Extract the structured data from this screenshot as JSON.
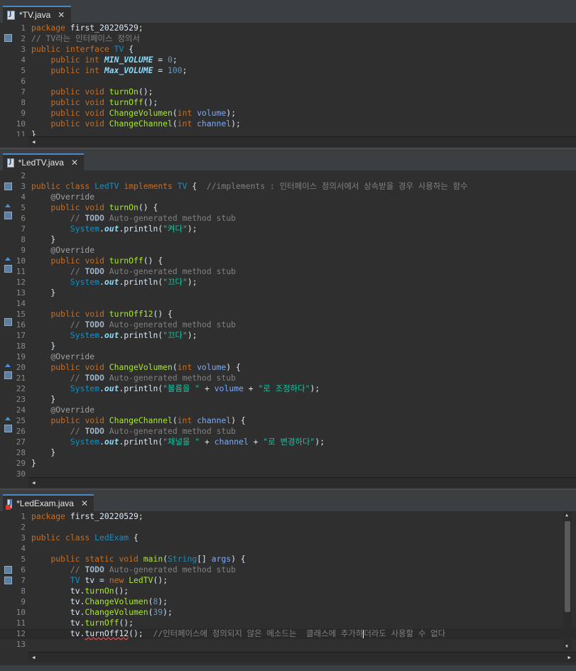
{
  "panes": [
    {
      "tab_label": "*TV.java",
      "lines": [
        {
          "n": "1",
          "code": "package first_20220529;"
        },
        {
          "n": "2",
          "code": "// TV라는 인터페이스 정의서"
        },
        {
          "n": "3",
          "code": "public interface TV {"
        },
        {
          "n": "4",
          "code": "    public int MIN_VOLUME = 0;"
        },
        {
          "n": "5",
          "code": "    public int Max_VOLUME = 100;"
        },
        {
          "n": "6",
          "code": ""
        },
        {
          "n": "7",
          "code": "    public void turnOn();"
        },
        {
          "n": "8",
          "code": "    public void turnOff();"
        },
        {
          "n": "9",
          "code": "    public void ChangeVolumen(int volume);"
        },
        {
          "n": "10",
          "code": "    public void ChangeChannel(int channel);"
        },
        {
          "n": "11",
          "code": "}"
        }
      ]
    },
    {
      "tab_label": "*LedTV.java",
      "lines": [
        {
          "n": "2",
          "code": ""
        },
        {
          "n": "3",
          "code": "public class LedTV implements TV {  //implements : 인터페이스 정의서에서 상속받을 경우 사용하는 함수"
        },
        {
          "n": "4",
          "code": "    @Override"
        },
        {
          "n": "5",
          "code": "    public void turnOn() {"
        },
        {
          "n": "6",
          "code": "        // TODO Auto-generated method stub"
        },
        {
          "n": "7",
          "code": "        System.out.println(\"켜다\");"
        },
        {
          "n": "8",
          "code": "    }"
        },
        {
          "n": "9",
          "code": "    @Override"
        },
        {
          "n": "10",
          "code": "    public void turnOff() {"
        },
        {
          "n": "11",
          "code": "        // TODO Auto-generated method stub"
        },
        {
          "n": "12",
          "code": "        System.out.println(\"끄다\");"
        },
        {
          "n": "13",
          "code": "    }"
        },
        {
          "n": "14",
          "code": ""
        },
        {
          "n": "15",
          "code": "    public void turnOff12() {"
        },
        {
          "n": "16",
          "code": "        // TODO Auto-generated method stub"
        },
        {
          "n": "17",
          "code": "        System.out.println(\"끄다\");"
        },
        {
          "n": "18",
          "code": "    }"
        },
        {
          "n": "19",
          "code": "    @Override"
        },
        {
          "n": "20",
          "code": "    public void ChangeVolumen(int volume) {"
        },
        {
          "n": "21",
          "code": "        // TODO Auto-generated method stub"
        },
        {
          "n": "22",
          "code": "        System.out.println(\"볼륨을 \" + volume + \"로 조정하다\");"
        },
        {
          "n": "23",
          "code": "    }"
        },
        {
          "n": "24",
          "code": "    @Override"
        },
        {
          "n": "25",
          "code": "    public void ChangeChannel(int channel) {"
        },
        {
          "n": "26",
          "code": "        // TODO Auto-generated method stub"
        },
        {
          "n": "27",
          "code": "        System.out.println(\"채널을 \" + channel + \"로 변경하다\");"
        },
        {
          "n": "28",
          "code": "    }"
        },
        {
          "n": "29",
          "code": "}"
        },
        {
          "n": "30",
          "code": ""
        }
      ]
    },
    {
      "tab_label": "*LedExam.java",
      "lines": [
        {
          "n": "1",
          "code": "package first_20220529;"
        },
        {
          "n": "2",
          "code": ""
        },
        {
          "n": "3",
          "code": "public class LedExam {"
        },
        {
          "n": "4",
          "code": ""
        },
        {
          "n": "5",
          "code": "    public static void main(String[] args) {"
        },
        {
          "n": "6",
          "code": "        // TODO Auto-generated method stub"
        },
        {
          "n": "7",
          "code": "        TV tv = new LedTV();"
        },
        {
          "n": "8",
          "code": "        tv.turnOn();"
        },
        {
          "n": "9",
          "code": "        tv.ChangeVolumen(8);"
        },
        {
          "n": "10",
          "code": "        tv.ChangeVolumen(39);"
        },
        {
          "n": "11",
          "code": "        tv.turnOff();"
        },
        {
          "n": "12",
          "code": "        tv.turnOff12();  //인터페이스에 정의되지 않은 메소드는  클래스에 추가하더라도 사용할 수 없다"
        },
        {
          "n": "13",
          "code": ""
        }
      ]
    }
  ],
  "icons": {
    "java_file": "java-file-icon",
    "close": "close-icon",
    "scroll_left": "◂",
    "scroll_right": "▸",
    "scroll_up": "▴",
    "scroll_down": "▾",
    "close_glyph": "✕"
  },
  "colors": {
    "keyword": "#cc6c1d",
    "method": "#a7ec21",
    "string": "#17c6a3",
    "comment": "#808080",
    "field": "#8ddaf8",
    "type": "#1290c3"
  }
}
